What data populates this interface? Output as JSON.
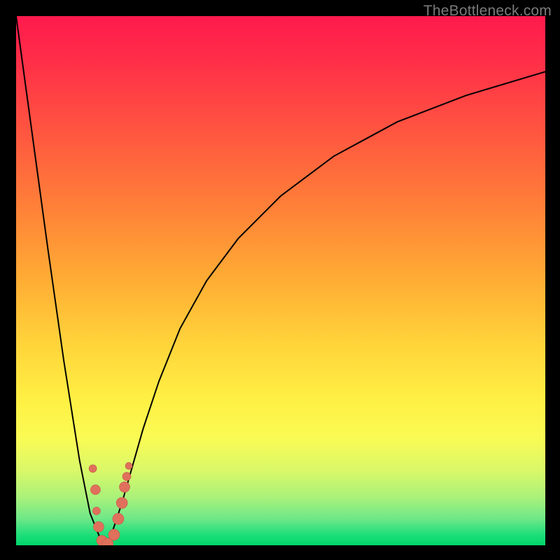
{
  "watermark": "TheBottleneck.com",
  "colors": {
    "page_bg": "#000000",
    "curve": "#000000",
    "dot_fill": "#e0705c",
    "dot_stroke": "#c15a47",
    "gradient_top": "#ff1a4d",
    "gradient_mid_upper": "#ff8038",
    "gradient_mid": "#fff144",
    "gradient_bottom": "#00d66a"
  },
  "chart_data": {
    "type": "line",
    "title": "",
    "xlabel": "",
    "ylabel": "",
    "xlim": [
      0,
      100
    ],
    "ylim": [
      0,
      100
    ],
    "note": "V-shaped bottleneck curve. Minimum (0%) near x≈17; rises steeply to 100% toward x→0 and asymptotically approaches ~90% as x→100. Pink dots cluster along both walls near the valley.",
    "series": [
      {
        "name": "bottleneck-curve",
        "x": [
          0,
          3,
          6,
          9,
          12,
          14,
          16,
          17,
          18,
          20,
          22,
          24,
          27,
          31,
          36,
          42,
          50,
          60,
          72,
          85,
          100
        ],
        "values": [
          100,
          78,
          56,
          35,
          16,
          6,
          1,
          0,
          2,
          8,
          15,
          22,
          31,
          41,
          50,
          58,
          66,
          73.5,
          80,
          85,
          89.5
        ]
      }
    ],
    "scatter": {
      "name": "highlight-dots",
      "points": [
        {
          "x": 14.5,
          "y": 14.5,
          "r": 5.5
        },
        {
          "x": 15.0,
          "y": 10.5,
          "r": 7.0
        },
        {
          "x": 15.2,
          "y": 6.5,
          "r": 5.5
        },
        {
          "x": 15.6,
          "y": 3.5,
          "r": 7.5
        },
        {
          "x": 16.2,
          "y": 0.9,
          "r": 7.5
        },
        {
          "x": 17.3,
          "y": 0.3,
          "r": 8.0
        },
        {
          "x": 18.5,
          "y": 2.0,
          "r": 8.0
        },
        {
          "x": 19.3,
          "y": 5.0,
          "r": 8.0
        },
        {
          "x": 20.0,
          "y": 8.0,
          "r": 8.0
        },
        {
          "x": 20.5,
          "y": 11.0,
          "r": 7.5
        },
        {
          "x": 20.9,
          "y": 13.0,
          "r": 6.0
        },
        {
          "x": 21.3,
          "y": 15.0,
          "r": 5.0
        }
      ]
    }
  }
}
